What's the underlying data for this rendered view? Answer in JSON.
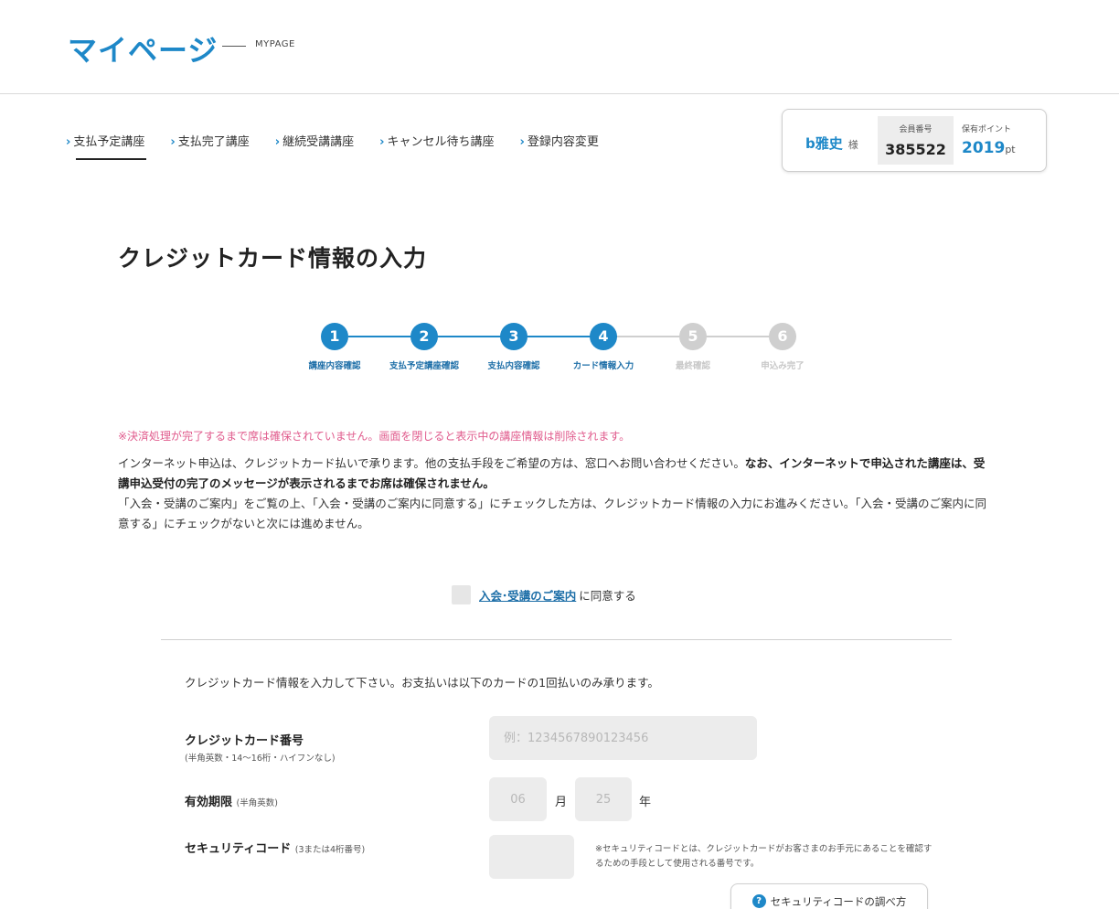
{
  "header": {
    "logo": "マイページ",
    "logo_sub": "MYPAGE"
  },
  "nav": {
    "items": [
      {
        "label": "支払予定講座",
        "active": true
      },
      {
        "label": "支払完了講座",
        "active": false
      },
      {
        "label": "継続受講講座",
        "active": false
      },
      {
        "label": "キャンセル待ち講座",
        "active": false
      },
      {
        "label": "登録内容変更",
        "active": false
      }
    ]
  },
  "member": {
    "name": "b雅史",
    "honorific": "様",
    "number_label": "会員番号",
    "number": "385522",
    "points_label": "保有ポイント",
    "points": "2019",
    "points_unit": "pt"
  },
  "page": {
    "title": "クレジットカード情報の入力"
  },
  "steps": [
    {
      "num": "1",
      "label": "講座内容確認",
      "state": "done"
    },
    {
      "num": "2",
      "label": "支払予定講座確認",
      "state": "done"
    },
    {
      "num": "3",
      "label": "支払内容確認",
      "state": "done"
    },
    {
      "num": "4",
      "label": "カード情報入力",
      "state": "current"
    },
    {
      "num": "5",
      "label": "最終確認",
      "state": "todo"
    },
    {
      "num": "6",
      "label": "申込み完了",
      "state": "todo"
    }
  ],
  "colors": {
    "accent": "#1e88c8",
    "notice": "#e05a8c",
    "step_inactive": "#cfcfcf"
  },
  "notice": "※決済処理が完了するまで席は確保されていません。画面を閉じると表示中の講座情報は削除されます。",
  "paragraph": {
    "line1_normal": "インターネット申込は、クレジットカード払いで承ります。他の支払手段をご希望の方は、窓口へお問い合わせください。",
    "line1_bold": "なお、インターネットで申込された講座は、受講申込受付の完了のメッセージが表示されるまでお席は確保されません。",
    "line2": "「入会・受講のご案内」をご覧の上、「入会・受講のご案内に同意する」にチェックした方は、クレジットカード情報の入力にお進みください。「入会・受講のご案内に同意する」にチェックがないと次には進めません。"
  },
  "agreement": {
    "link": "入会･受講のご案内",
    "suffix": "に同意する"
  },
  "card": {
    "intro": "クレジットカード情報を入力して下さい。お支払いは以下のカードの1回払いのみ承ります。",
    "number_label": "クレジットカード番号",
    "number_sub": "(半角英数・14～16桁・ハイフンなし)",
    "number_placeholder": "例：1234567890123456",
    "expiry_label": "有効期限",
    "expiry_sub": "(半角英数)",
    "expiry_month": "06",
    "expiry_month_unit": "月",
    "expiry_year": "25",
    "expiry_year_unit": "年",
    "security_label": "セキュリティコード",
    "security_sub": "(3または4桁番号)",
    "security_value": "",
    "security_note": "※セキュリティコードとは、クレジットカードがお客さまのお手元にあることを確認するための手段として使用される番号です。",
    "security_help_button": "セキュリティコードの調べ方"
  }
}
